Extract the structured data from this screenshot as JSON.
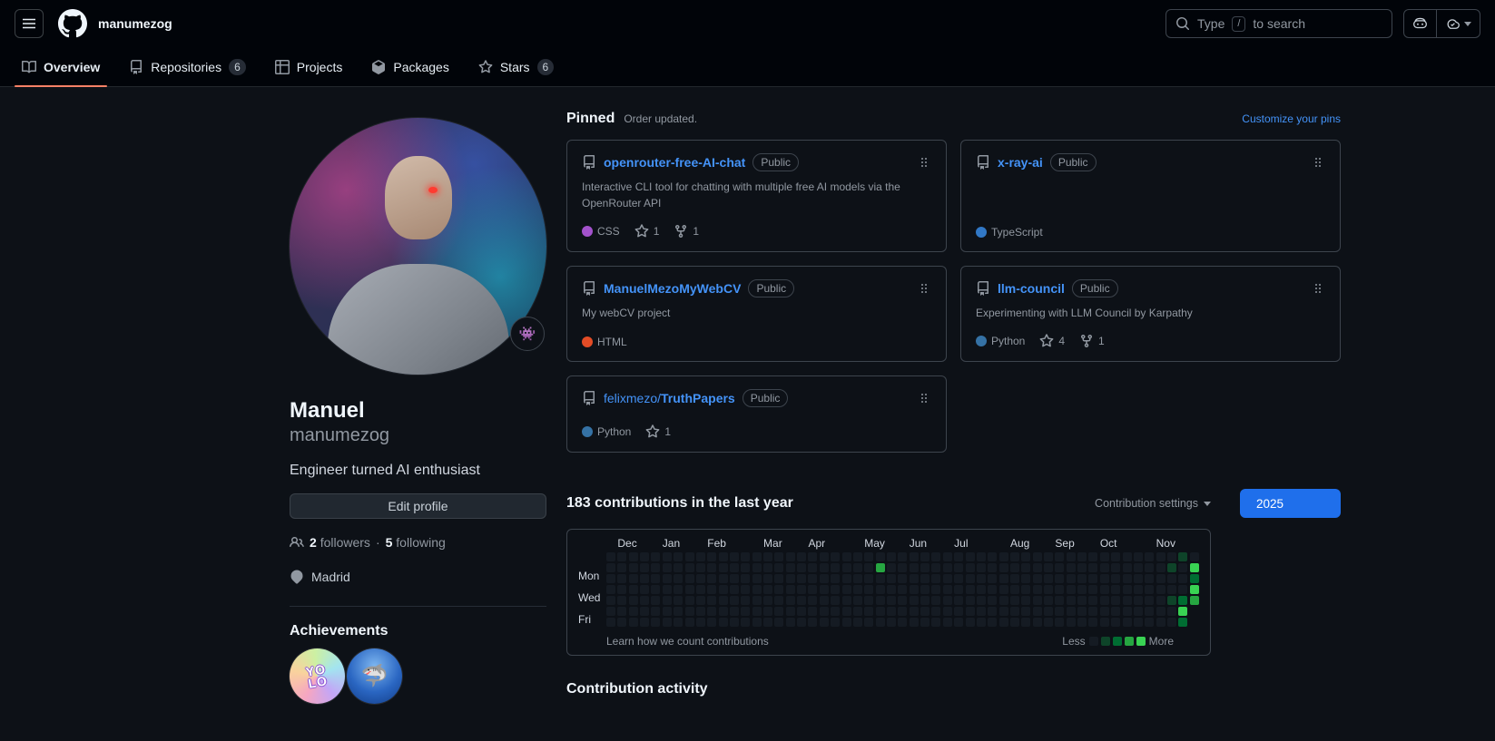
{
  "header": {
    "context_name": "manumezog",
    "search": {
      "prefix": "Type",
      "slash_key": "/",
      "suffix": "to search"
    }
  },
  "tabs": [
    {
      "label": "Overview",
      "count": "",
      "active": true
    },
    {
      "label": "Repositories",
      "count": "6",
      "active": false
    },
    {
      "label": "Projects",
      "count": "",
      "active": false
    },
    {
      "label": "Packages",
      "count": "",
      "active": false
    },
    {
      "label": "Stars",
      "count": "6",
      "active": false
    }
  ],
  "profile": {
    "name": "Manuel",
    "login": "manumezog",
    "bio": "Engineer turned AI enthusiast",
    "edit_button": "Edit profile",
    "followers_count": "2",
    "followers_label": "followers",
    "separator": "·",
    "following_count": "5",
    "following_label": "following",
    "location": "Madrid",
    "status_emoji": "👾",
    "achievements_title": "Achievements",
    "achievements": [
      {
        "name": "YOLO"
      },
      {
        "name": "Pull Shark"
      }
    ],
    "yolo_line1": "YO",
    "yolo_line2": "LO",
    "shark_emoji": "🦈"
  },
  "pinned": {
    "title": "Pinned",
    "subtitle": "Order updated.",
    "customize_link": "Customize your pins",
    "repos": [
      {
        "owner": "",
        "name": "openrouter-free-AI-chat",
        "visibility": "Public",
        "description": "Interactive CLI tool for chatting with multiple free AI models via the OpenRouter API",
        "language": "CSS",
        "language_color": "#a352cc",
        "stars": "1",
        "forks": "1"
      },
      {
        "owner": "",
        "name": "x-ray-ai",
        "visibility": "Public",
        "description": "",
        "language": "TypeScript",
        "language_color": "#3178c6",
        "stars": "",
        "forks": ""
      },
      {
        "owner": "",
        "name": "ManuelMezoMyWebCV",
        "visibility": "Public",
        "description": "My webCV project",
        "language": "HTML",
        "language_color": "#e34c26",
        "stars": "",
        "forks": ""
      },
      {
        "owner": "",
        "name": "llm-council",
        "visibility": "Public",
        "description": "Experimenting with LLM Council by Karpathy",
        "language": "Python",
        "language_color": "#3572A5",
        "stars": "4",
        "forks": "1"
      },
      {
        "owner": "felixmezo/",
        "name": "TruthPapers",
        "visibility": "Public",
        "description": "",
        "language": "Python",
        "language_color": "#3572A5",
        "stars": "1",
        "forks": ""
      }
    ]
  },
  "contributions": {
    "title": "183 contributions in the last year",
    "settings_label": "Contribution settings",
    "year_button": "2025",
    "months": [
      {
        "label": "Dec",
        "week": 1
      },
      {
        "label": "Jan",
        "week": 5
      },
      {
        "label": "Feb",
        "week": 9
      },
      {
        "label": "Mar",
        "week": 14
      },
      {
        "label": "Apr",
        "week": 18
      },
      {
        "label": "May",
        "week": 23
      },
      {
        "label": "Jun",
        "week": 27
      },
      {
        "label": "Jul",
        "week": 31
      },
      {
        "label": "Aug",
        "week": 36
      },
      {
        "label": "Sep",
        "week": 40
      },
      {
        "label": "Oct",
        "week": 44
      },
      {
        "label": "Nov",
        "week": 49
      }
    ],
    "day_labels": [
      {
        "label": "Mon",
        "row": 1
      },
      {
        "label": "Wed",
        "row": 3
      },
      {
        "label": "Fri",
        "row": 5
      }
    ],
    "weeks": 53,
    "last_week_days": 5,
    "empty_color": "#151b23",
    "level_colors": [
      "#0e4429",
      "#006d32",
      "#26a641",
      "#39d353"
    ],
    "cells": [
      {
        "week": 24,
        "day": 1,
        "level": 3
      },
      {
        "week": 50,
        "day": 1,
        "level": 1
      },
      {
        "week": 50,
        "day": 4,
        "level": 1
      },
      {
        "week": 51,
        "day": 0,
        "level": 1
      },
      {
        "week": 51,
        "day": 4,
        "level": 2
      },
      {
        "week": 51,
        "day": 5,
        "level": 4
      },
      {
        "week": 51,
        "day": 6,
        "level": 2
      },
      {
        "week": 52,
        "day": 1,
        "level": 4
      },
      {
        "week": 52,
        "day": 2,
        "level": 2
      },
      {
        "week": 52,
        "day": 3,
        "level": 4
      },
      {
        "week": 52,
        "day": 4,
        "level": 3
      }
    ],
    "footer_link": "Learn how we count contributions",
    "legend_less": "Less",
    "legend_more": "More"
  },
  "activity": {
    "title": "Contribution activity"
  },
  "colors": {
    "link_blue": "#4493f8",
    "tab_underline": "#f78166",
    "year_button_bg": "#1f6feb",
    "header_bg": "#010409",
    "page_bg": "#0d1117"
  }
}
